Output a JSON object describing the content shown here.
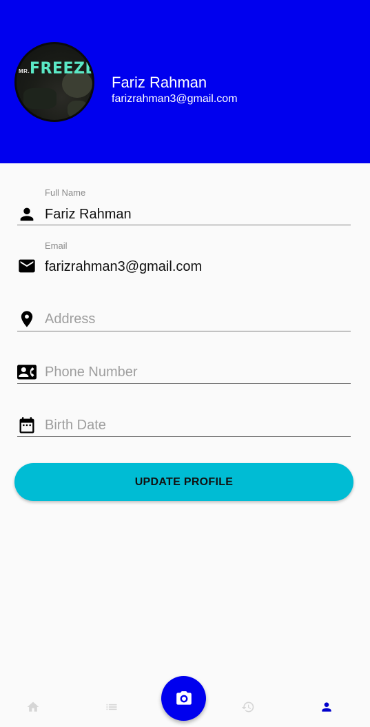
{
  "colors": {
    "header_bg": "#0000ee",
    "button_bg": "#00bcd4",
    "fab_bg": "#0000ee",
    "nav_active": "#0000cc",
    "nav_inactive": "#d6d6d6"
  },
  "header": {
    "avatar_logo_small": "MR.",
    "avatar_logo_main": "FREEZE",
    "name": "Fariz Rahman",
    "email": "farizrahman3@gmail.com"
  },
  "form": {
    "full_name": {
      "label": "Full Name",
      "value": "Fariz Rahman",
      "icon": "person-icon"
    },
    "email": {
      "label": "Email",
      "value": "farizrahman3@gmail.com",
      "icon": "mail-icon"
    },
    "address": {
      "placeholder": "Address",
      "icon": "location-pin-icon"
    },
    "phone": {
      "placeholder": "Phone Number",
      "icon": "contact-phone-icon"
    },
    "birth_date": {
      "placeholder": "Birth Date",
      "icon": "calendar-icon"
    },
    "update_button": "UPDATE PROFILE"
  },
  "bottom_nav": {
    "items": [
      {
        "icon": "home-icon",
        "active": false
      },
      {
        "icon": "list-icon",
        "active": false
      },
      {
        "icon": "camera-icon",
        "active": false
      },
      {
        "icon": "history-icon",
        "active": false
      },
      {
        "icon": "person-icon",
        "active": true
      }
    ]
  }
}
